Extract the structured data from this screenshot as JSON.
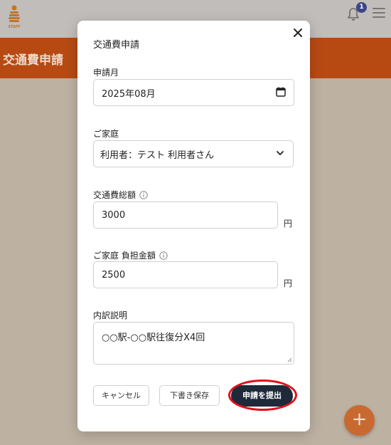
{
  "app": {
    "logo_text": "STAFF",
    "notification_count": "1",
    "page_title": "交通費申請",
    "fab_label": "+"
  },
  "modal": {
    "title": "交通費申請",
    "month": {
      "label": "申請月",
      "value": "2025年08月"
    },
    "family": {
      "label": "ご家庭",
      "selected": "利用者：テスト 利用者さん"
    },
    "total": {
      "label": "交通費総額",
      "value": "3000",
      "unit": "円"
    },
    "burden": {
      "label": "ご家庭 負担金額",
      "value": "2500",
      "unit": "円"
    },
    "detail": {
      "label": "内訳説明",
      "value": "○○駅-○○駅往復分X4回"
    },
    "buttons": {
      "cancel": "キャンセル",
      "draft": "下書き保存",
      "submit": "申請を提出"
    }
  },
  "colors": {
    "header": "#b74a13",
    "submit": "#1e2a3a",
    "highlight": "#e0121b",
    "badge": "#3d4488"
  }
}
